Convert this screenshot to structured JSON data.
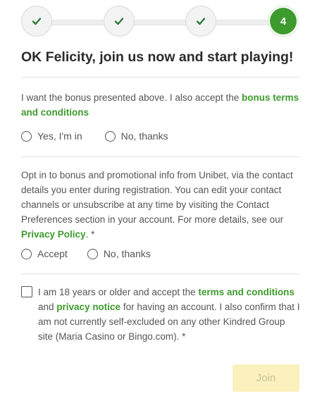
{
  "stepper": {
    "steps": [
      {
        "state": "done",
        "icon": "check-icon"
      },
      {
        "state": "done",
        "icon": "check-icon"
      },
      {
        "state": "done",
        "icon": "check-icon"
      },
      {
        "state": "active",
        "label": "4"
      }
    ],
    "colors": {
      "accent": "#3d9b2d",
      "done_check": "#2d7a35"
    }
  },
  "title": "OK Felicity, join us now and start playing!",
  "bonus": {
    "text_before": "I want the bonus presented above. I also accept the ",
    "link": "bonus terms and conditions",
    "options": [
      "Yes, I'm in",
      "No, thanks"
    ]
  },
  "promo": {
    "text_before": "Opt in to bonus and promotional info from Unibet, via the contact details you enter during registration. You can edit your contact channels or unsubscribe at any time by visiting the Contact Preferences section in your account. For more details, see our ",
    "link": "Privacy Policy",
    "text_after": ". *",
    "options": [
      "Accept",
      "No, thanks"
    ]
  },
  "terms": {
    "text_1": "I am 18 years or older and accept the ",
    "link_1": "terms and conditions",
    "text_2": " and ",
    "link_2": "privacy notice",
    "text_3": " for having an account. I also confirm that I am not currently self-excluded on any other Kindred Group site (Maria Casino or Bingo.com). *"
  },
  "join_button": "Join"
}
